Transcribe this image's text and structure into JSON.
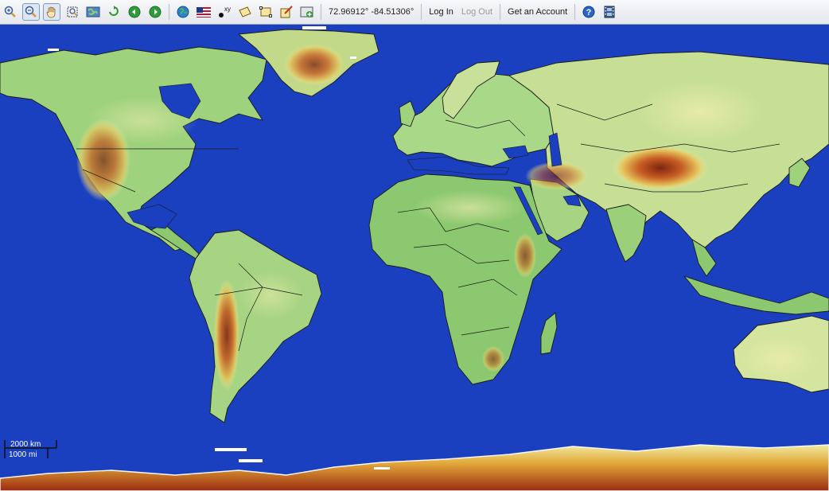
{
  "toolbar": {
    "tools": [
      {
        "name": "zoom-in-icon"
      },
      {
        "name": "zoom-out-icon",
        "active": true
      },
      {
        "name": "pan-hand-icon",
        "active": true
      },
      {
        "name": "zoom-box-icon"
      },
      {
        "name": "full-extent-icon"
      },
      {
        "name": "refresh-icon"
      },
      {
        "name": "back-arrow-icon"
      },
      {
        "name": "forward-arrow-icon"
      },
      {
        "name": "globe-icon"
      },
      {
        "name": "us-flag-icon"
      },
      {
        "name": "xy-point-icon"
      },
      {
        "name": "draw-polygon-icon"
      },
      {
        "name": "draw-rectangle-icon"
      },
      {
        "name": "edit-shape-icon"
      },
      {
        "name": "add-layer-icon"
      }
    ],
    "coordinates": "72.96912° -84.51306°",
    "login_label": "Log In",
    "logout_label": "Log Out",
    "account_label": "Get an Account",
    "help_icon": "help-icon",
    "film_icon": "film-strip-icon"
  },
  "map": {
    "ocean_color": "#1a3fbf",
    "land_low": "#9ad07a",
    "land_mid": "#f0eaa0",
    "land_high": "#c8561e",
    "land_peak": "#7a1a0a"
  },
  "scale": {
    "metric_label": "2000 km",
    "imperial_label": "1000 mi"
  }
}
